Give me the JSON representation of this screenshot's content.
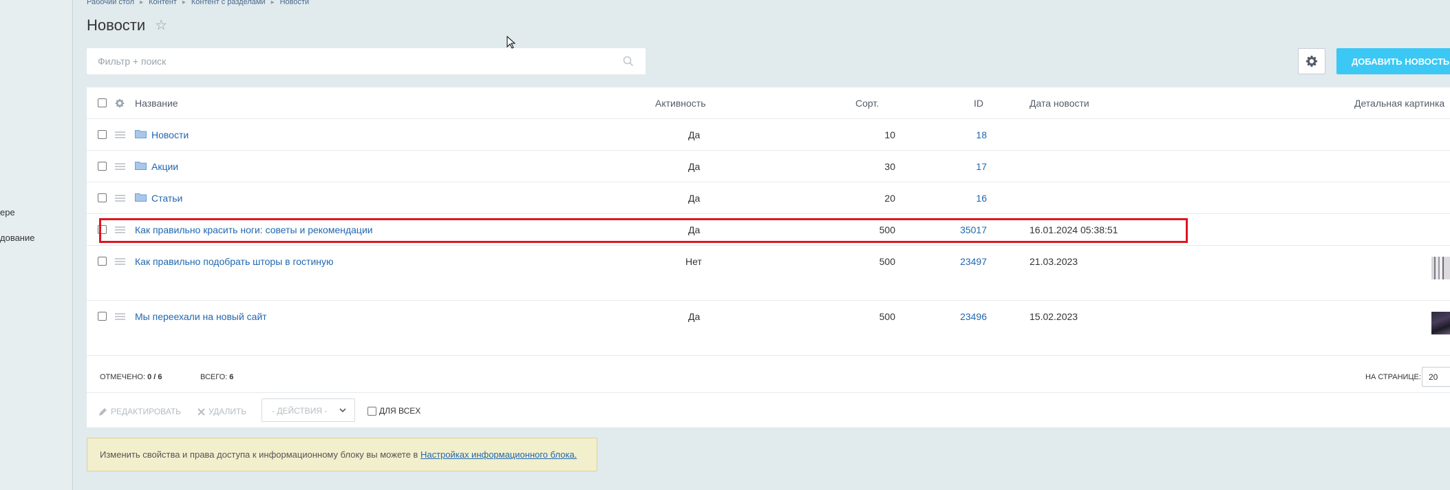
{
  "sidebar": {
    "item1": "ере",
    "item2": "дование"
  },
  "breadcrumb": [
    "Рабочий стол",
    "Контент",
    "Контент с разделами",
    "Новости"
  ],
  "page": {
    "title": "Новости"
  },
  "search": {
    "placeholder": "Фильтр + поиск",
    "value": ""
  },
  "toolbar": {
    "add_label": "ДОБАВИТЬ НОВОСТЬ"
  },
  "table": {
    "headers": {
      "name": "Название",
      "active": "Активность",
      "sort": "Сорт.",
      "id": "ID",
      "date": "Дата новости",
      "picture": "Детальная картинка"
    },
    "rows": [
      {
        "type": "section",
        "name": "Новости",
        "active": "Да",
        "sort": "10",
        "id": "18",
        "date": ""
      },
      {
        "type": "section",
        "name": "Акции",
        "active": "Да",
        "sort": "30",
        "id": "17",
        "date": ""
      },
      {
        "type": "section",
        "name": "Статьи",
        "active": "Да",
        "sort": "20",
        "id": "16",
        "date": ""
      },
      {
        "type": "element",
        "name": "Как правильно красить ноги: советы и рекомендации",
        "active": "Да",
        "sort": "500",
        "id": "35017",
        "date": "16.01.2024 05:38:51"
      },
      {
        "type": "element",
        "name": "Как правильно подобрать шторы в гостиную",
        "active": "Нет",
        "sort": "500",
        "id": "23497",
        "date": "21.03.2023"
      },
      {
        "type": "element",
        "name": "Мы переехали на новый сайт",
        "active": "Да",
        "sort": "500",
        "id": "23496",
        "date": "15.02.2023"
      }
    ]
  },
  "footer": {
    "selected_label": "ОТМЕЧЕНО:",
    "selected_value": "0 / 6",
    "total_label": "ВСЕГО:",
    "total_value": "6",
    "per_page_label": "НА СТРАНИЦЕ:",
    "per_page_value": "20"
  },
  "actions": {
    "edit": "РЕДАКТИРОВАТЬ",
    "delete": "УДАЛИТЬ",
    "select": "- ДЕЙСТВИЯ -",
    "for_all": "ДЛЯ ВСЕХ"
  },
  "notice": {
    "text": "Изменить свойства и права доступа к информационному блоку вы можете в",
    "link": "Настройках информационного блока."
  },
  "colors": {
    "accent": "#3bc8f5",
    "link": "#2067b0",
    "highlight": "#e0141e",
    "background": "#e1eaed"
  }
}
